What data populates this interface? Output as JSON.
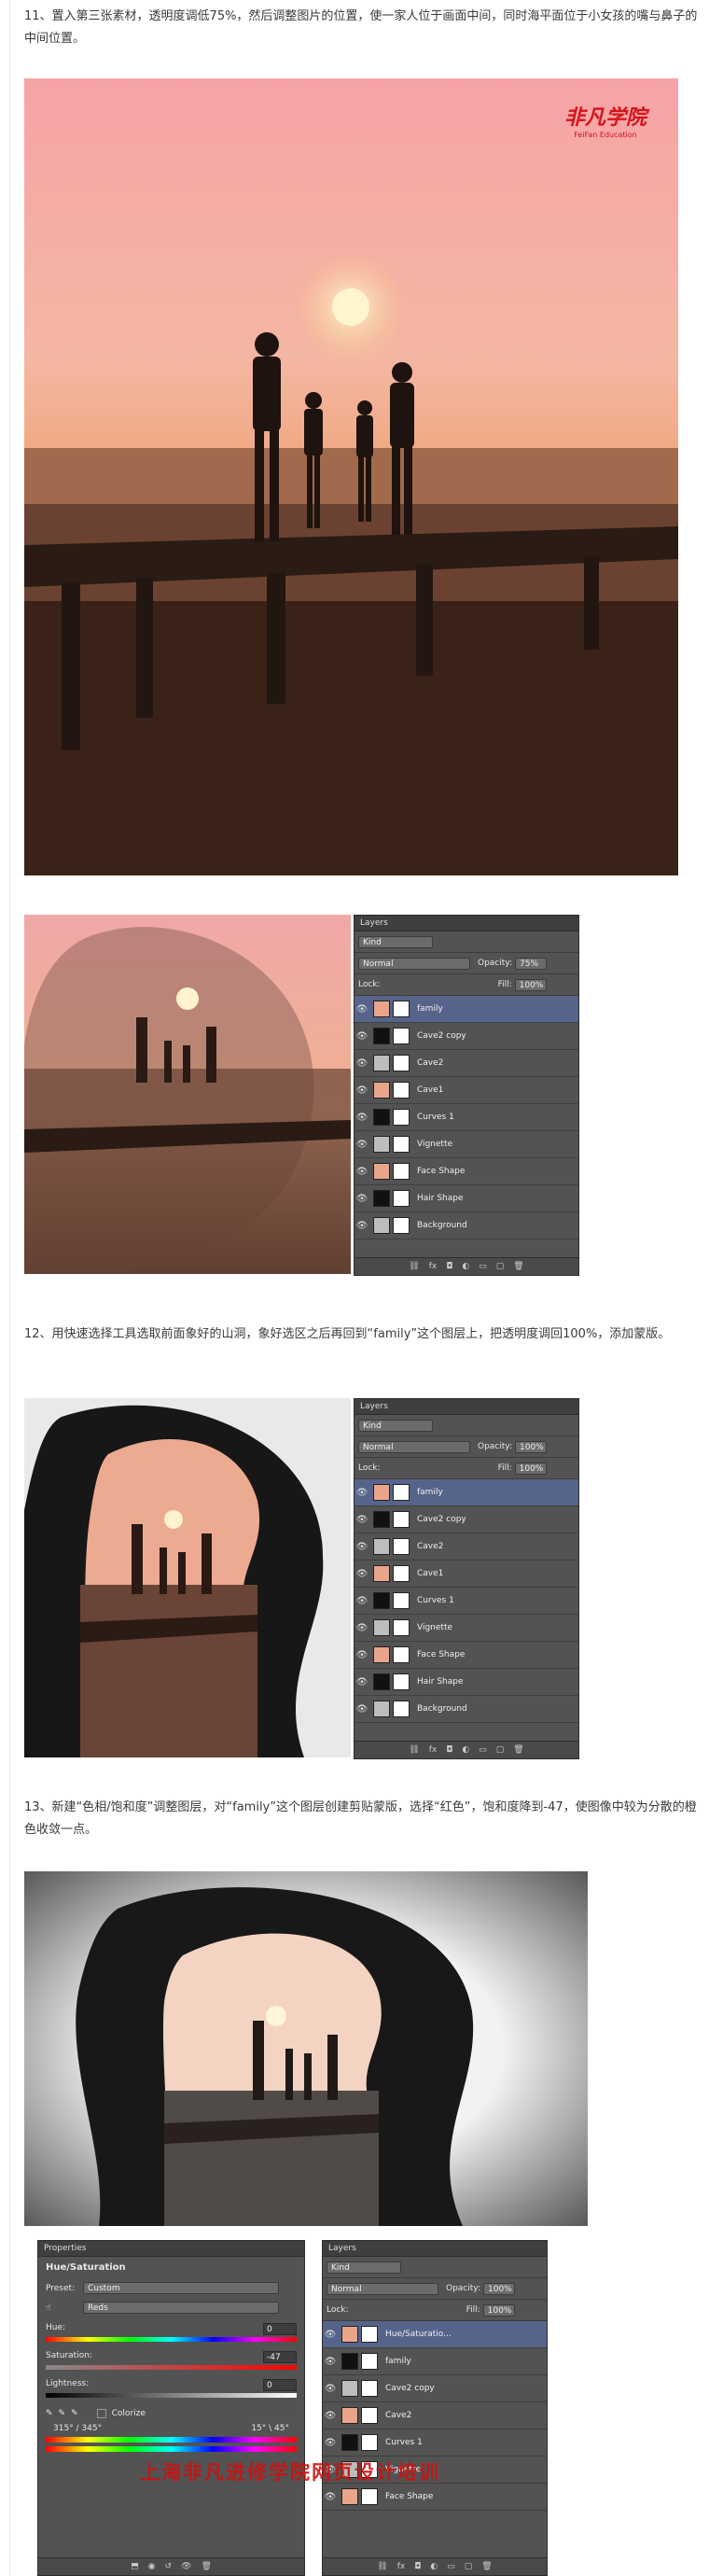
{
  "step11": {
    "text": "11、置入第三张素材，透明度调低75%，然后调整图片的位置，使一家人位于画面中间，同时海平面位于小女孩的嘴与鼻子的中间位置。",
    "logo_cn": "非凡学院",
    "logo_en": "FeiFan Education"
  },
  "step12": {
    "text": "12、用快速选择工具选取前面象好的山洞，象好选区之后再回到“family”这个图层上，把透明度调回100%，添加蒙版。"
  },
  "step13": {
    "text": "13、新建“色相/饱和度”调整图层，对“family”这个图层创建剪贴蒙版，选择“红色”，饱和度降到-47，使图像中较为分散的橙色收敛一点。"
  },
  "watermark": "上海非凡进修学院网页设计培训",
  "layers_panel_1": {
    "title": "Layers",
    "kind": "Kind",
    "blend": "Normal",
    "opacity_label": "Opacity:",
    "opacity": "75%",
    "lock_label": "Lock:",
    "fill_label": "Fill:",
    "fill": "100%",
    "layers": [
      "family",
      "Cave2 copy",
      "Cave2",
      "Cave1",
      "Curves 1",
      "Vignette",
      "Face Shape",
      "Hair Shape",
      "Background"
    ]
  },
  "layers_panel_2": {
    "title": "Layers",
    "kind": "Kind",
    "blend": "Normal",
    "opacity_label": "Opacity:",
    "opacity": "100%",
    "lock_label": "Lock:",
    "fill_label": "Fill:",
    "fill": "100%",
    "layers": [
      "family",
      "Cave2 copy",
      "Cave2",
      "Cave1",
      "Curves 1",
      "Vignette",
      "Face Shape",
      "Hair Shape",
      "Background"
    ]
  },
  "layers_panel_3": {
    "title": "Layers",
    "kind": "Kind",
    "blend": "Normal",
    "opacity_label": "Opacity:",
    "opacity": "100%",
    "lock_label": "Lock:",
    "fill_label": "Fill:",
    "fill": "100%",
    "layers": [
      "Hue/Saturatio...",
      "family",
      "Cave2 copy",
      "Cave2",
      "Curves 1",
      "Vignette",
      "Face Shape"
    ]
  },
  "properties": {
    "title": "Properties",
    "subtitle": "Hue/Saturation",
    "preset_label": "Preset:",
    "preset": "Custom",
    "channel": "Reds",
    "hue_label": "Hue:",
    "hue": "0",
    "sat_label": "Saturation:",
    "sat": "-47",
    "light_label": "Lightness:",
    "light": "0",
    "colorize": "Colorize",
    "range_left": "315° / 345°",
    "range_right": "15° \\ 45°"
  },
  "colors": {
    "panel": "#535353",
    "selected": "#56648b",
    "watermark": "#cc1111"
  }
}
